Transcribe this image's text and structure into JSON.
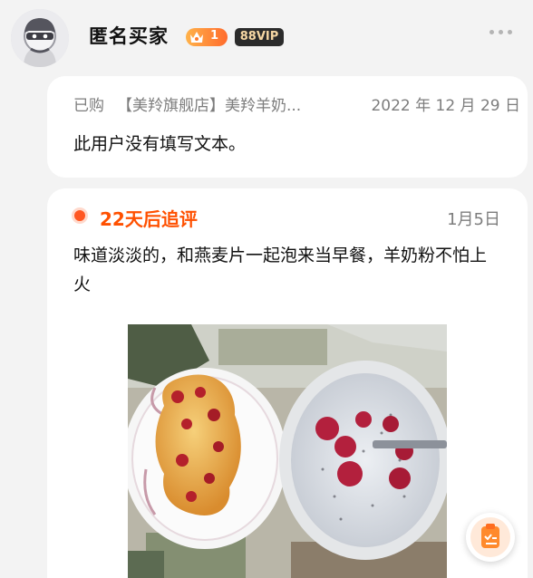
{
  "header": {
    "username": "匿名买家",
    "level": "1",
    "vip": "88VIP"
  },
  "review": {
    "bought_label": "已购",
    "product": "【美羚旗舰店】美羚羊奶...",
    "date": "2022 年 12 月 29 日",
    "text": "此用户没有填写文本。"
  },
  "followup": {
    "label": "22天后追评",
    "date": "1月5日",
    "text": "味道淡淡的，和燕麦片一起泡来当早餐，羊奶粉不怕上火"
  },
  "colors": {
    "accent": "#ff5000",
    "vip_bg": "#2b2b2b",
    "vip_text": "#f6d7a3",
    "page_bg": "#f3f3f3"
  },
  "icons": {
    "more": "more-dots-icon",
    "crown": "crown-icon",
    "float": "note-icon"
  }
}
